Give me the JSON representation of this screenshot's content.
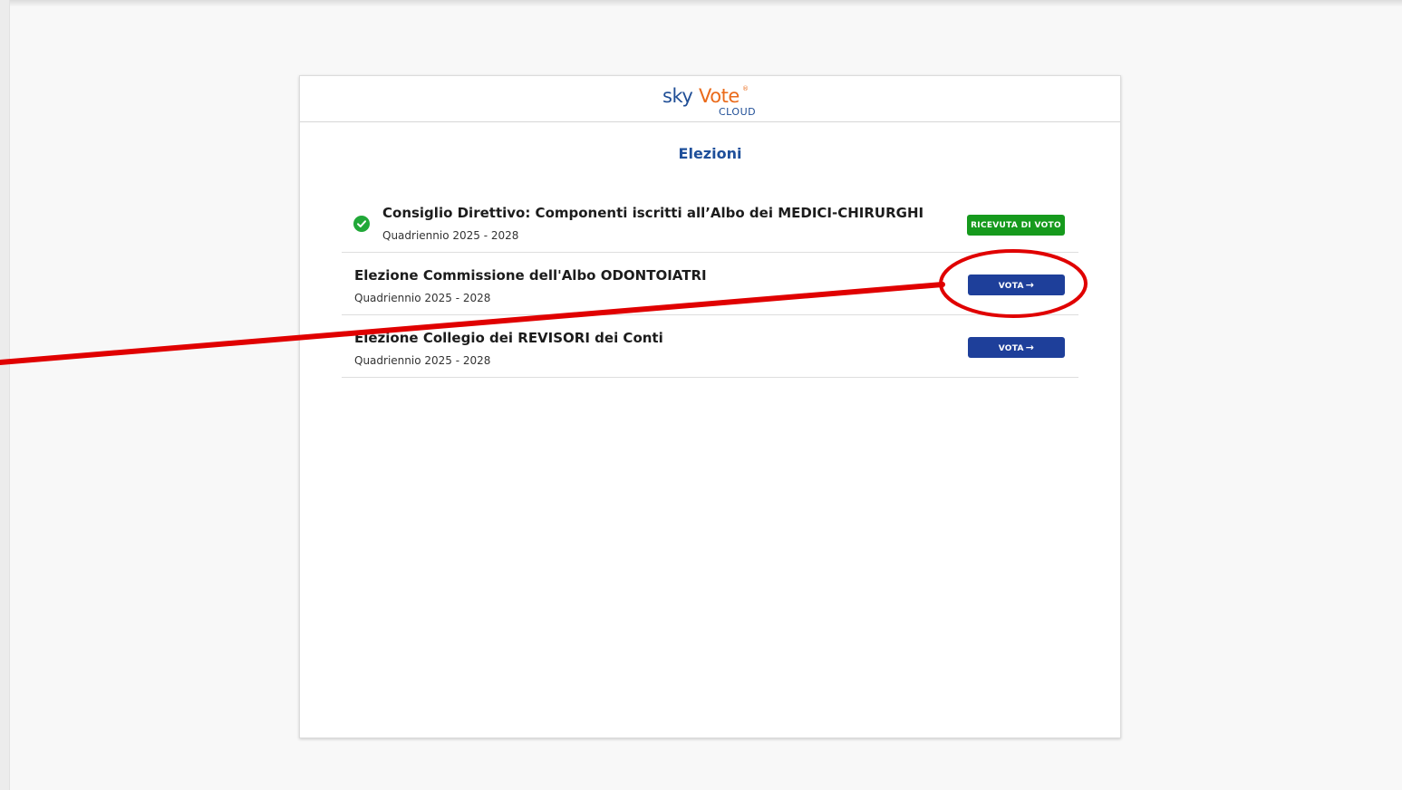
{
  "logo": {
    "sky": "sky",
    "vote": "Vote",
    "reg": "®",
    "cloud": "CLOUD"
  },
  "page": {
    "title": "Elezioni"
  },
  "elections": [
    {
      "name": "Consiglio Direttivo: Componenti iscritti all’Albo dei MEDICI-CHIRURGHI",
      "period": "Quadriennio 2025 - 2028",
      "voted": true,
      "action_label": "RICEVUTA DI VOTO"
    },
    {
      "name": "Elezione Commissione dell'Albo ODONTOIATRI",
      "period": "Quadriennio 2025 - 2028",
      "voted": false,
      "action_label": "VOTA"
    },
    {
      "name": "Elezione Collegio dei REVISORI dei Conti",
      "period": "Quadriennio 2025 - 2028",
      "voted": false,
      "action_label": "VOTA"
    }
  ],
  "colors": {
    "brand_blue": "#1f4e96",
    "brand_orange": "#ea6a1a",
    "vote_button": "#1e3f9a",
    "receipt_button": "#169a1d",
    "annotation_red": "#e00000"
  }
}
